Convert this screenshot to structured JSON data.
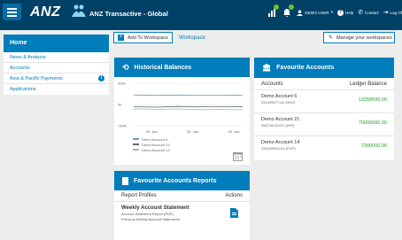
{
  "header": {
    "logo_text": "ANZ",
    "app_title": "ANZ Transactive - Global",
    "user_label": "DEMO USER",
    "help_label": "Help",
    "contact_label": "Contact",
    "logoff_label": "Log Of"
  },
  "sidebar": {
    "title": "Home",
    "items": [
      {
        "label": "News & Analysis"
      },
      {
        "label": "Accounts"
      },
      {
        "label": "Asia & Pacific Payments",
        "badge": "i"
      },
      {
        "label": "Applications"
      }
    ]
  },
  "toolbar": {
    "add_label": "Add To Workspace",
    "workspace_label": "Workspace",
    "manage_label": "Manage your workspaces"
  },
  "historical": {
    "title": "Historical Balances",
    "chart_data": {
      "type": "line",
      "x": [
        "25. Jan",
        "25. Jan",
        "26. Jan"
      ],
      "ylim": [
        -200000000,
        200000000
      ],
      "y_ticks": [
        "200k",
        "0k",
        "-200k"
      ],
      "series": [
        {
          "name": "Demo Account 6",
          "values": [
            90000000,
            86000000,
            89000000,
            87000000,
            88000000,
            86000000
          ],
          "color": "#6a9bc3"
        },
        {
          "name": "Demo Account 13",
          "values": [
            -20000000,
            -25000000,
            -18000000,
            -22000000,
            -20000000,
            -19000000
          ],
          "color": "#666666"
        },
        {
          "name": "Demo Account 14",
          "values": [
            -40000000,
            -45000000,
            -42000000,
            -48000000,
            -46000000,
            -50000000
          ],
          "color": "#8fb9d9"
        }
      ],
      "title": "",
      "xlabel": "",
      "ylabel": ""
    }
  },
  "favourite_accounts": {
    "title": "Favourite Accounts",
    "col_accounts": "Accounts",
    "col_balance": "Ledger Balance",
    "rows": [
      {
        "name": "Demo Account 6",
        "number": "331335677111 (HKD)",
        "balance": "13258000.00"
      },
      {
        "name": "Demo Account 21",
        "number": "566718221220 (INR)",
        "balance": "70000000.00"
      },
      {
        "name": "Demo Account 14",
        "number": "345439801243 (PHP)",
        "balance": "7300000.00"
      }
    ]
  },
  "reports": {
    "title": "Favourite Accounts Reports",
    "col_profiles": "Report Profiles",
    "col_actions": "Actions",
    "row_title": "Weekly Account Statement",
    "row_sub1": "Account Statement Report (PDF)",
    "row_sub2": "Previous Weekly Account Statements"
  },
  "colors": {
    "brand": "#004165",
    "accent": "#007dba",
    "positive": "#2a9d2a"
  }
}
